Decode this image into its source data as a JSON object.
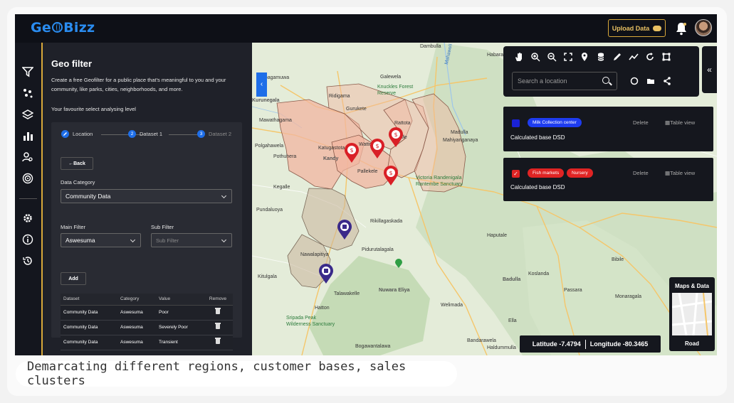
{
  "brand": {
    "logo_left": "Ge",
    "logo_right": "Bizz",
    "accent": "#2a8cf0"
  },
  "header": {
    "upload_label": "Upload Data",
    "upload_icon": "cloud-upload-icon",
    "bell_icon": "bell-icon",
    "avatar_icon": "user-avatar"
  },
  "rail": {
    "icons": [
      "filter-icon",
      "cluster-icon",
      "layers-icon",
      "bar-chart-icon",
      "search-user-icon",
      "target-icon",
      "settings-icon",
      "info-icon",
      "history-icon"
    ]
  },
  "panel": {
    "title": "Geo filter",
    "description": "Create a free Geofilter for a public place that's meaningful to you and your community, like parks, cities, neighborhoods, and more.",
    "level_text": "Your favourite select analysing level",
    "steps": [
      {
        "num": "",
        "label": "Location"
      },
      {
        "num": "2",
        "label": "Dataset 1"
      },
      {
        "num": "3",
        "label": "Dataset 2"
      }
    ],
    "back_label": "Back",
    "data_category_label": "Data Category",
    "data_category_value": "Community Data",
    "main_filter_label": "Main Filter",
    "main_filter_value": "Aswesuma",
    "sub_filter_label": "Sub Filter",
    "sub_filter_placeholder": "Sub Filter",
    "add_label": "Add",
    "table": {
      "headers": [
        "Dataset",
        "Category",
        "Value",
        "Remove"
      ],
      "rows": [
        [
          "Community Data",
          "Aswesuma",
          "Poor"
        ],
        [
          "Community Data",
          "Aswesuma",
          "Severely Poor"
        ],
        [
          "Community Data",
          "Aswesuma",
          "Transient"
        ]
      ]
    }
  },
  "map": {
    "search_placeholder": "Search a location",
    "toolbar_icons": [
      "hand-icon",
      "zoom-in-icon",
      "zoom-out-icon",
      "fullscreen-icon",
      "pin-icon",
      "database-icon",
      "pencil-icon",
      "trend-icon",
      "refresh-icon",
      "crop-icon"
    ],
    "toolbar_icons_row2": [
      "circle-icon",
      "folder-icon",
      "share-icon"
    ],
    "labels": {
      "ibbagamuwa": "Ibbagamuwa",
      "galewela": "Galewela",
      "dambulla": "Dambulla",
      "habarana": "Habarana",
      "kurunegala": "Kurunegala",
      "mawathagama": "Mawathagama",
      "ridigama": "Ridigama",
      "gurukete": "Gurukete",
      "rattota": "Rattota",
      "wattegama": "Wattegama",
      "knuckles": "Knuckles Forest Reserve",
      "pallekele": "Pallekele",
      "matale": "Matale",
      "madulla": "Madulla",
      "mahiyanganaya": "Mahiyanganaya",
      "polgahawela": "Polgahawela",
      "pothuhera": "Pothuhera",
      "katugastota": "Katugastota",
      "kandy": "Kandy",
      "kegalle": "Kegalle",
      "pundaluoya": "Pundaluoya",
      "victoria": "Victoria Randenigala Rantembe Sanctuary",
      "rikillagaskada": "Rikillagaskada",
      "nawalapitiya": "Nawalapitiya",
      "pidurutalagala": "Pidurutalagala",
      "kitulgala": "Kitulgala",
      "nuwara_eliya": "Nuwara Eliya",
      "talawakelle": "Talawakelle",
      "hatton": "Hatton",
      "sripada": "Sripada Peak Wilderness Sanctuary",
      "bogawantalawa": "Bogawantalawa",
      "welimada": "Welimada",
      "bandarawela": "Bandarawela",
      "haputale": "Haputale",
      "badulla": "Badulla",
      "passara": "Passara",
      "ella": "Ella",
      "bibile": "Bibile",
      "monaragala": "Monaragala",
      "koslanda": "Koslanda",
      "haldummulla": "Haldummulla",
      "mahaweli": "Mahaweli Ganga"
    }
  },
  "layers": [
    {
      "checked": false,
      "chips": [
        {
          "text": "Milk Collection center",
          "color": "#1e3cf0"
        }
      ],
      "desc": "Calculated base DSD",
      "delete": "Delete",
      "table_view": "Table view",
      "color": "#1a22d6"
    },
    {
      "checked": true,
      "chips": [
        {
          "text": "Fish markets",
          "color": "#e02424"
        },
        {
          "text": "Nursery",
          "color": "#e02424"
        }
      ],
      "desc": "Calculated base DSD",
      "delete": "Delete",
      "table_view": "Table view",
      "color": "#e02424"
    }
  ],
  "coords": {
    "lat_label": "Latitude -7.4794",
    "lon_label": "Longitude -80.3465"
  },
  "maps_data": {
    "title": "Maps & Data",
    "type": "Road"
  },
  "caption": "Demarcating different regions, customer bases, sales clusters"
}
